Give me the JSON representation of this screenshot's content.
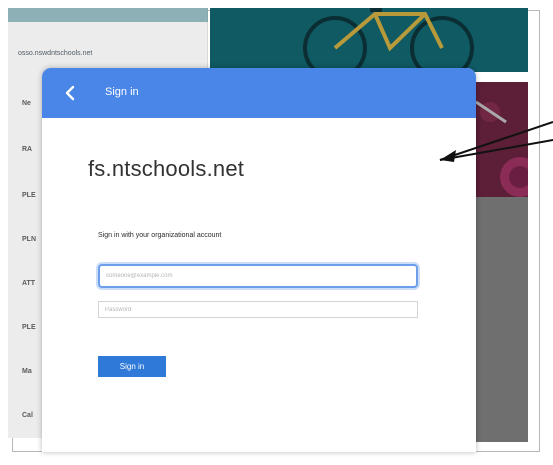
{
  "background": {
    "url_text": "osso.nswdntschools.net",
    "list_items": [
      "Ne",
      "RA",
      "PLE",
      "PLN",
      "ATT",
      "PLE",
      "Ma",
      "Cal"
    ]
  },
  "dialog": {
    "header": {
      "title": "Sign in",
      "back_icon": "chevron-left-icon"
    },
    "domain": "fs.ntschools.net",
    "instruction": "Sign in with your organizational account",
    "username": {
      "value": "",
      "placeholder": "someone@example.com"
    },
    "password": {
      "value": "",
      "placeholder": "Password"
    },
    "submit_label": "Sign in"
  },
  "colors": {
    "header_blue": "#4a86e8",
    "button_blue": "#2f7ad8",
    "focus_ring": "#6d9eeb"
  }
}
